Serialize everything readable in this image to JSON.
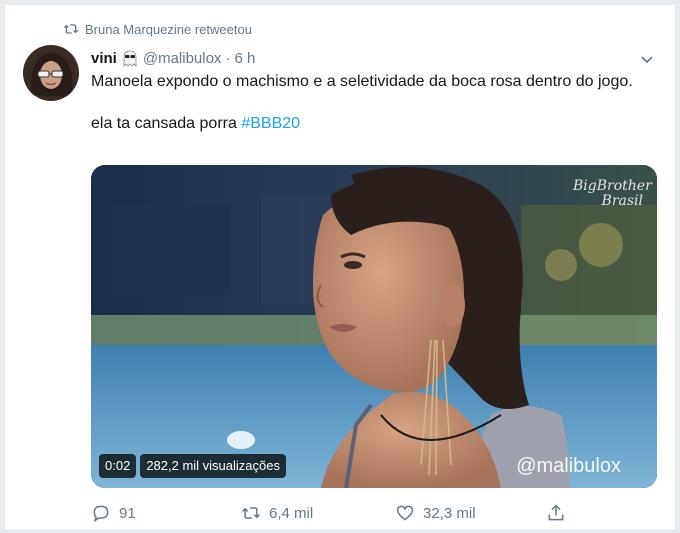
{
  "retweet_context": {
    "text": "Bruna Marquezine retweetou",
    "icon": "retweet-icon"
  },
  "author": {
    "name": "vini",
    "emoji": "ghost-sunglasses-emoji",
    "handle": "@malibulox",
    "separator": "·",
    "time": "6 h"
  },
  "tweet": {
    "line1": "Manoela expondo o machismo e a seletividade da boca rosa dentro do jogo.",
    "line2_prefix": "ela ta cansada porra ",
    "hashtag": "#BBB20"
  },
  "video": {
    "logo_line1": "BigBrother",
    "logo_line2": "Brasil",
    "time": "0:02",
    "views": "282,2 mil visualizações",
    "watermark": "@malibulox"
  },
  "actions": {
    "replies": "91",
    "retweets": "6,4 mil",
    "likes": "32,3 mil"
  },
  "colors": {
    "link": "#1da1f2",
    "secondary_text": "#657786",
    "primary_text": "#14171a"
  }
}
